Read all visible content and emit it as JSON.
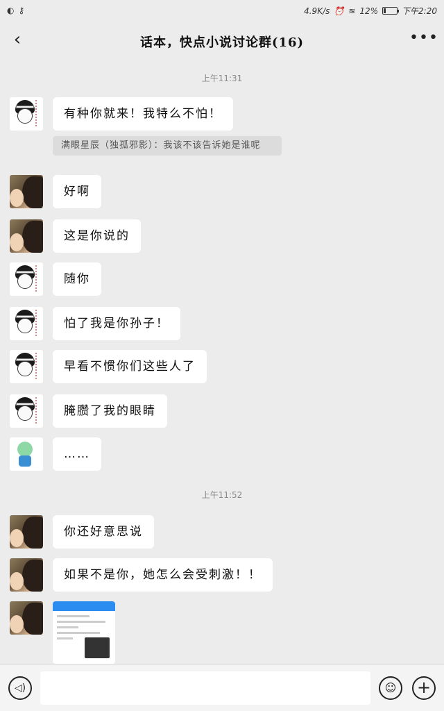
{
  "status": {
    "net_speed": "4.9K/s",
    "battery": "12%",
    "battery_level": 0.12,
    "time": "下午2:20"
  },
  "header": {
    "back_icon": "‹",
    "title": "话本，快点小说讨论群(16)",
    "more_icon": "•••"
  },
  "chat": {
    "timestamps": [
      "上午11:31",
      "上午11:52"
    ],
    "messages": [
      {
        "avatar": "girl",
        "text": "有种你就来！我特么不怕！"
      },
      {
        "avatar": "couple",
        "text": "好啊"
      },
      {
        "avatar": "couple",
        "text": "这是你说的"
      },
      {
        "avatar": "girl",
        "text": "随你"
      },
      {
        "avatar": "girl",
        "text": "怕了我是你孙子！"
      },
      {
        "avatar": "girl",
        "text": "早看不惯你们这些人了"
      },
      {
        "avatar": "girl",
        "text": "腌臜了我的眼睛"
      },
      {
        "avatar": "anime",
        "text": "……"
      },
      {
        "avatar": "couple",
        "text": "你还好意思说"
      },
      {
        "avatar": "couple",
        "text": "如果不是你，她怎么会受刺激！！"
      }
    ],
    "reply_quote": "满眼星辰（独孤邪影）：我该不该告诉她是谁呢"
  },
  "input": {
    "placeholder": "",
    "voice_icon": "voice-icon",
    "emoji_icon": "emoji-icon",
    "plus_icon": "plus-icon"
  }
}
